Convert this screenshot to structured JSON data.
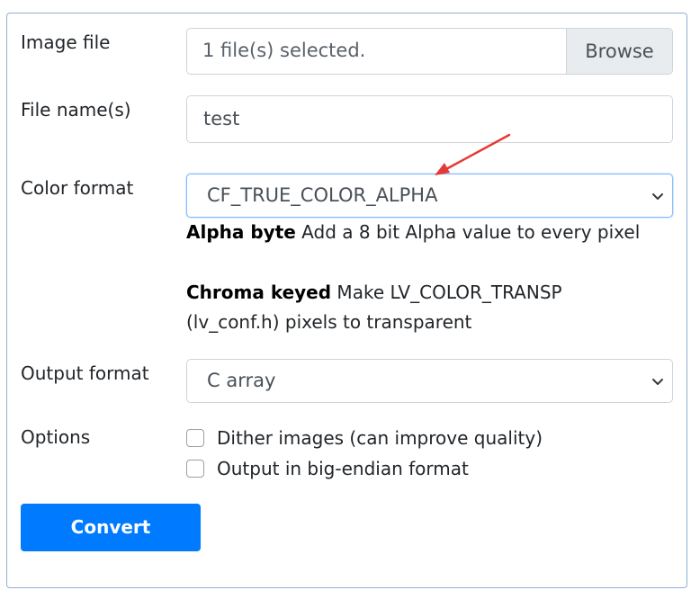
{
  "form": {
    "image_file": {
      "label": "Image file",
      "value": "1 file(s) selected.",
      "browse_label": "Browse"
    },
    "file_names": {
      "label": "File name(s)",
      "value": "test"
    },
    "color_format": {
      "label": "Color format",
      "selected": "CF_TRUE_COLOR_ALPHA",
      "help": [
        {
          "term": "Alpha byte",
          "text": " Add a 8 bit Alpha value to every pixel"
        },
        {
          "term": "Chroma keyed",
          "text": " Make LV_COLOR_TRANSP (lv_conf.h) pixels to transparent"
        }
      ]
    },
    "output_format": {
      "label": "Output format",
      "selected": "C array"
    },
    "options": {
      "label": "Options",
      "items": [
        {
          "label": "Dither images (can improve quality)",
          "checked": false
        },
        {
          "label": "Output in big-endian format",
          "checked": false
        }
      ]
    },
    "convert_label": "Convert"
  },
  "colors": {
    "primary": "#007bff",
    "annotation_arrow": "#e53935"
  },
  "icons": {
    "select_chevron": "chevron-down-icon",
    "annotation": "red-arrow-icon"
  }
}
